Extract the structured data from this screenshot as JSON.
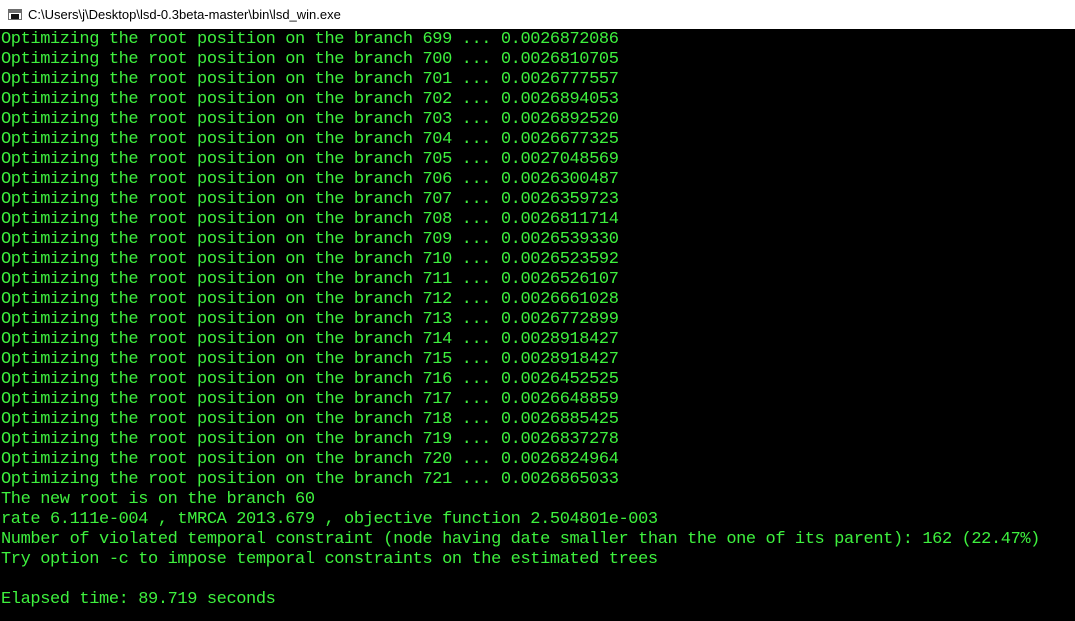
{
  "window": {
    "title": "C:\\Users\\j\\Desktop\\lsd-0.3beta-master\\bin\\lsd_win.exe",
    "icon": "console-app-icon"
  },
  "console": {
    "text_color": "#3ef03e",
    "background": "#000000",
    "lines": [
      "Optimizing the root position on the branch 699 ... 0.0026872086",
      "Optimizing the root position on the branch 700 ... 0.0026810705",
      "Optimizing the root position on the branch 701 ... 0.0026777557",
      "Optimizing the root position on the branch 702 ... 0.0026894053",
      "Optimizing the root position on the branch 703 ... 0.0026892520",
      "Optimizing the root position on the branch 704 ... 0.0026677325",
      "Optimizing the root position on the branch 705 ... 0.0027048569",
      "Optimizing the root position on the branch 706 ... 0.0026300487",
      "Optimizing the root position on the branch 707 ... 0.0026359723",
      "Optimizing the root position on the branch 708 ... 0.0026811714",
      "Optimizing the root position on the branch 709 ... 0.0026539330",
      "Optimizing the root position on the branch 710 ... 0.0026523592",
      "Optimizing the root position on the branch 711 ... 0.0026526107",
      "Optimizing the root position on the branch 712 ... 0.0026661028",
      "Optimizing the root position on the branch 713 ... 0.0026772899",
      "Optimizing the root position on the branch 714 ... 0.0028918427",
      "Optimizing the root position on the branch 715 ... 0.0028918427",
      "Optimizing the root position on the branch 716 ... 0.0026452525",
      "Optimizing the root position on the branch 717 ... 0.0026648859",
      "Optimizing the root position on the branch 718 ... 0.0026885425",
      "Optimizing the root position on the branch 719 ... 0.0026837278",
      "Optimizing the root position on the branch 720 ... 0.0026824964",
      "Optimizing the root position on the branch 721 ... 0.0026865033",
      "The new root is on the branch 60",
      "rate 6.111e-004 , tMRCA 2013.679 , objective function 2.504801e-003",
      "Number of violated temporal constraint (node having date smaller than the one of its parent): 162 (22.47%)",
      "Try option -c to impose temporal constraints on the estimated trees",
      "",
      "Elapsed time: 89.719 seconds"
    ]
  }
}
